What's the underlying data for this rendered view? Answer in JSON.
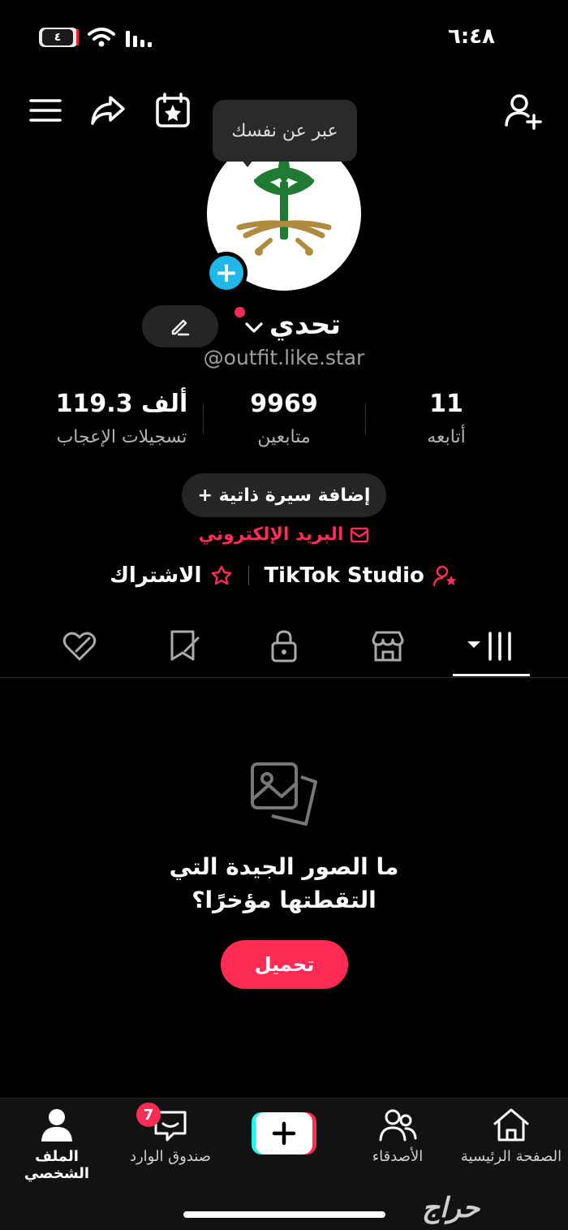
{
  "status_bar": {
    "time": "٦:٤٨",
    "battery_level": "٤"
  },
  "tooltip": {
    "text": "عبر عن نفسك"
  },
  "profile": {
    "name": "تحدي",
    "handle": "@outfit.like.star"
  },
  "stats": {
    "following": {
      "value": "11",
      "label": "أتابعه"
    },
    "followers": {
      "value": "9969",
      "label": "متابعين"
    },
    "likes": {
      "value": "119.3 ألف",
      "label": "تسجيلات الإعجاب"
    }
  },
  "bio_button": "+ إضافة سيرة ذاتية",
  "email_link": "البريد الإلكتروني",
  "links": {
    "studio": "TikTok Studio",
    "subscription": "الاشتراك"
  },
  "tabs": [
    "videos",
    "shop",
    "private",
    "saved",
    "liked"
  ],
  "empty_state": {
    "title_line1": "ما الصور الجيدة التي",
    "title_line2": "التقطتها مؤخرًا؟",
    "button": "تحميل"
  },
  "bottom_nav": {
    "home": "الصفحة الرئيسية",
    "friends": "الأصدقاء",
    "inbox": "صندوق الوارد",
    "inbox_badge": "7",
    "profile": "الملف الشخصي"
  },
  "watermark": "حراج",
  "colors": {
    "accent": "#fe2c55",
    "plus_badge": "#20b8e8",
    "background": "#000000"
  }
}
